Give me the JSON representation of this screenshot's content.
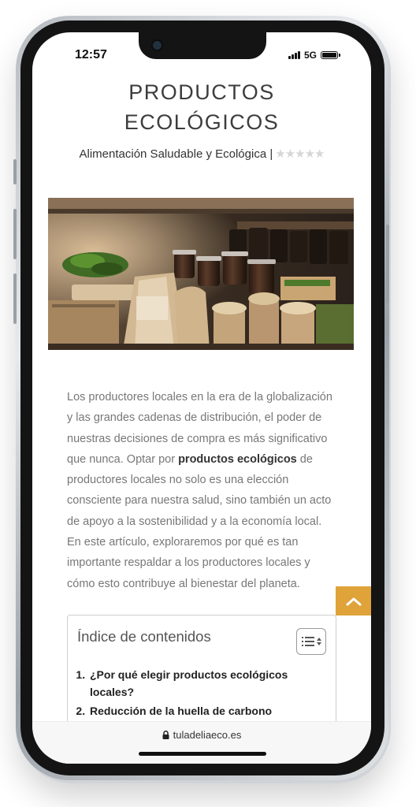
{
  "status_bar": {
    "time": "12:57",
    "network": "5G"
  },
  "article": {
    "title_line1": "PRODUCTOS",
    "title_line2": "ECOLÓGICOS",
    "category": "Alimentación Saludable y Ecológica |",
    "rating_stars": "★★★★★",
    "rating_value": 0,
    "rating_max": 5,
    "body_part1": "Los productores locales en la era de la globalización y las grandes cadenas de distribución, el poder de nuestras decisiones de compra es más significativo que nunca. Optar por ",
    "body_bold": "productos ecológicos",
    "body_part2": " de productores locales no solo es una elección consciente para nuestra salud, sino también un acto de apoyo a la sostenibilidad y a la economía local. En este artículo, exploraremos por qué es tan importante respaldar a los productores locales y cómo esto contribuye al bienestar del planeta."
  },
  "toc": {
    "title": "Índice de contenidos",
    "items": [
      "¿Por qué elegir productos ecológicos locales?",
      "Reducción de la huella de carbono"
    ]
  },
  "browser": {
    "url": "tuladeliaeco.es"
  },
  "colors": {
    "accent": "#e0a33a",
    "text": "#777777"
  },
  "icons": {
    "scroll_top": "chevron-up-icon",
    "lock": "lock-icon",
    "toc_toggle": "list-icon"
  }
}
